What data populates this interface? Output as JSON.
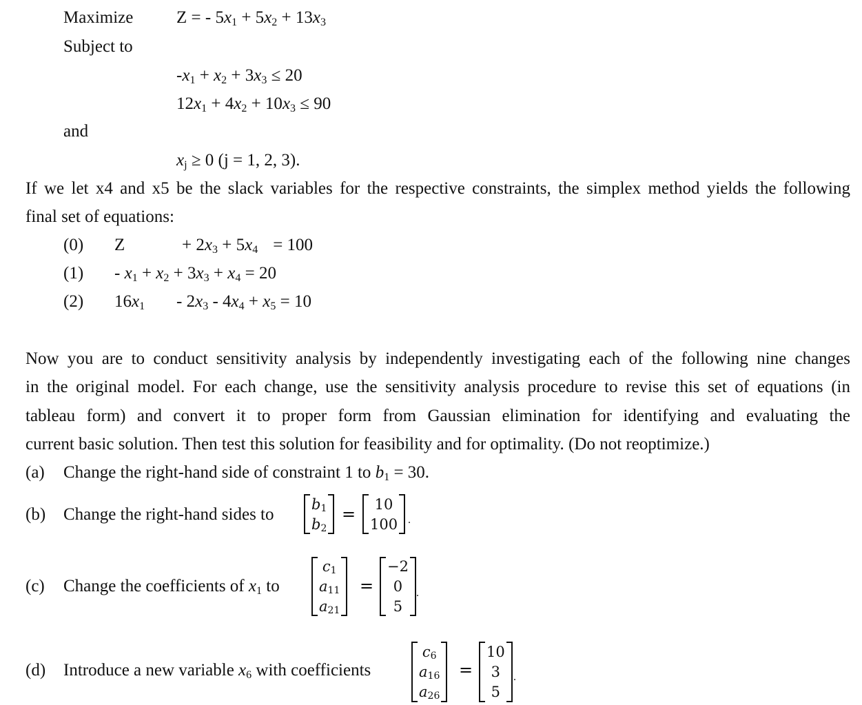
{
  "problem": {
    "maximize_label": "Maximize",
    "objective": {
      "lhs": "Z",
      "terms": [
        {
          "text": " = - 5",
          "var": "x",
          "sub": "1"
        },
        {
          "text": " + 5",
          "var": "x",
          "sub": "2"
        },
        {
          "text": " + 13",
          "var": "x",
          "sub": "3"
        }
      ]
    },
    "subject_to_label": "Subject to",
    "constraints": [
      {
        "pre1": "-",
        "s1": "1",
        "mid1": " + ",
        "s2": "2",
        "mid2": " + 3",
        "s3": "3",
        "rhs": " ≤ 20"
      },
      {
        "pre1": "12",
        "s1": "1",
        "mid1": " + 4",
        "s2": "2",
        "mid2": " + 10",
        "s3": "3",
        "rhs": " ≤ 90"
      }
    ],
    "and_label": "and",
    "nonneg": {
      "sub": "j",
      "rest": " ≥ 0 (j = 1, 2, 3)."
    }
  },
  "intro_text": {
    "line1": "If we let x4 and x5 be the slack variables for the respective constraints, the simplex method yields the following",
    "line2": "final set of equations:"
  },
  "final_equations": [
    {
      "label": "(0)",
      "lead": "Z",
      "body": {
        "a": "+ 2",
        "s_a": "3",
        "b": " + 5",
        "s_b": "4",
        "rhs": "= 100"
      }
    },
    {
      "label": "(1)",
      "lead": "- ",
      "body": {
        "s1": "1",
        "t2": " + ",
        "s2": "2",
        "t3": " + 3",
        "s3": "3",
        "t4": " + ",
        "s4": "4",
        "rhs": " = 20"
      }
    },
    {
      "label": "(2)",
      "lead": "16",
      "body": {
        "s1": "1",
        "t3": "- 2",
        "s3": "3",
        "t4": " - 4",
        "s4": "4",
        "t5": " + ",
        "s5": "5",
        "rhs": " = 10"
      }
    }
  ],
  "instructions": {
    "lines": [
      "Now you are to conduct sensitivity analysis by independently investigating each of the following nine changes",
      "in the original model. For each change, use the sensitivity analysis procedure to revise this set of equations (in",
      "tableau form) and convert it to proper form from Gaussian elimination for identifying and evaluating the",
      "current basic solution. Then test this solution for feasibility and for optimality. (Do not reoptimize.)"
    ]
  },
  "parts": {
    "a": {
      "label": "(a)",
      "text": "Change the right-hand side of constraint 1 to ",
      "var": "b",
      "sub": "1",
      "rest": " = 30."
    },
    "b": {
      "label": "(b)",
      "text": "Change the right-hand sides to",
      "lhs": [
        {
          "v": "b",
          "s": "1"
        },
        {
          "v": "b",
          "s": "2"
        }
      ],
      "rhs": [
        "10",
        "100"
      ],
      "eq": "=",
      "end": "."
    },
    "c": {
      "label": "(c)",
      "text": "Change the coefficients of ",
      "var": "x",
      "sub": "1",
      "text2": " to",
      "lhs": [
        {
          "v": "c",
          "s": "1"
        },
        {
          "v": "a",
          "s": "11"
        },
        {
          "v": "a",
          "s": "21"
        }
      ],
      "rhs": [
        "−2",
        "0",
        "5"
      ],
      "eq": "=",
      "end": "."
    },
    "d": {
      "label": "(d)",
      "text": "Introduce a new variable ",
      "var": "x",
      "sub": "6",
      "text2": " with coefficients",
      "lhs": [
        {
          "v": "c",
          "s": "6"
        },
        {
          "v": "a",
          "s": "16"
        },
        {
          "v": "a",
          "s": "26"
        }
      ],
      "rhs": [
        "10",
        "3",
        "5"
      ],
      "eq": "=",
      "end": "."
    }
  }
}
